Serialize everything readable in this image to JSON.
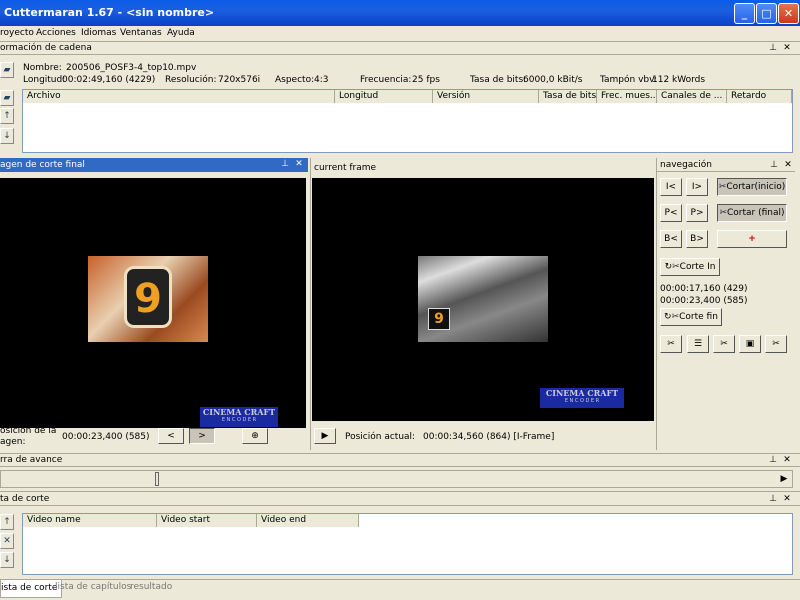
{
  "window": {
    "title": "Cuttermaran 1.67 - <sin nombre>",
    "minimize": "_",
    "maximize": "□",
    "close": "✕"
  },
  "menu": [
    "royecto",
    "Acciones",
    "Idiomas",
    "Ventanas",
    "Ayuda"
  ],
  "stream_info": {
    "header": "ormación de cadena",
    "name_label": "Nombre:",
    "name_value": "200506_POSF3-4_top10.mpv",
    "length_label": "Longitud:",
    "length_value": "00:02:49,160 (4229)",
    "resolution_label": "Resolución:",
    "resolution_value": "720x576i",
    "aspect_label": "Aspecto:",
    "aspect_value": "4:3",
    "frequency_label": "Frecuencia:",
    "frequency_value": "25 fps",
    "bitrate_label": "Tasa de bits:",
    "bitrate_value": "6000,0 kBit/s",
    "vbv_label": "Tampón vbv:",
    "vbv_value": "112 kWords",
    "columns": [
      "Archivo",
      "Longitud",
      "Versión",
      "Tasa de bits",
      "Frec. mues...",
      "Canales de ...",
      "Retardo"
    ]
  },
  "cut_image": {
    "header": "agen de corte final",
    "pos_label_1": "osición de la",
    "pos_label_2": "agen:",
    "pos_value": "00:00:23,400 (585)",
    "prev": "<",
    "next": ">",
    "logo": "CINEMA CRAFT",
    "logo_sub": "E N C O D E R"
  },
  "current_frame": {
    "header": "current frame",
    "play": "▶",
    "pos_label": "Posición actual:",
    "pos_value": "00:00:34,560 (864) [I-Frame]",
    "logo": "CINEMA CRAFT",
    "logo_sub": "E N C O D E R"
  },
  "navigation": {
    "header": "navegación",
    "i_back": "I<",
    "i_fwd": "I>",
    "p_back": "P<",
    "p_fwd": "P>",
    "b_back": "B<",
    "b_fwd": "B>",
    "cut_start": "Cortar(inicio)",
    "cut_end": "Cortar (final)",
    "cut_in": "Corte In",
    "cut_out": "Corte fin",
    "time_in": "00:00:17,160 (429)",
    "time_out": "00:00:23,400 (585)"
  },
  "progress": {
    "header": "rra de avance",
    "value": 0.2
  },
  "cut_list": {
    "header": "ta de corte",
    "columns": [
      "Video name",
      "Video start",
      "Video end"
    ]
  },
  "tabs": [
    "ista de corte",
    "lista de capítulos",
    "resultado"
  ]
}
